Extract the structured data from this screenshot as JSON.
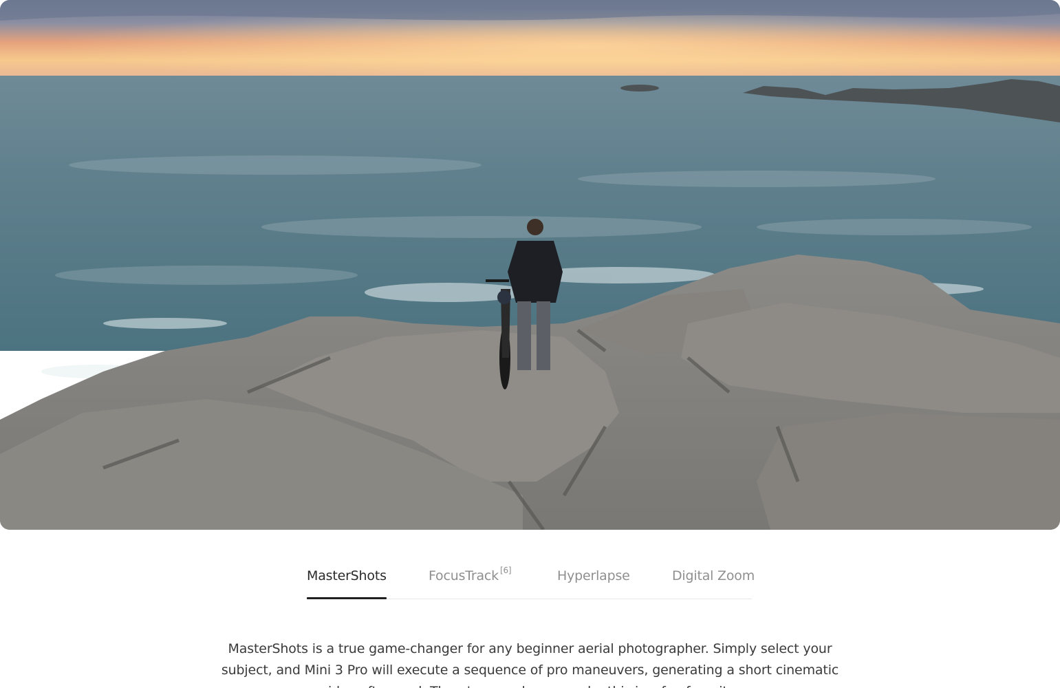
{
  "hero": {
    "image_subject": "person-with-bicycle-on-coastal-rocks-at-sunset"
  },
  "tabs": [
    {
      "label": "MasterShots",
      "sup": "",
      "active": true
    },
    {
      "label": "FocusTrack",
      "sup": "[6]",
      "active": false
    },
    {
      "label": "Hyperlapse",
      "sup": "",
      "active": false
    },
    {
      "label": "Digital Zoom",
      "sup": "",
      "active": false
    }
  ],
  "description": {
    "text": "MasterShots is a true game-changer for any beginner aerial photographer. Simply select your subject, and Mini 3 Pro will execute a sequence of pro maneuvers, generating a short cinematic video afterward. There's a good reason why this is a fan favorite."
  },
  "colors": {
    "active_tab": "#2a2a2a",
    "inactive_tab": "#8f8f8f",
    "underline": "#1f1f1f",
    "divider": "#e6e6e6",
    "body_text": "#3a3a3a"
  }
}
